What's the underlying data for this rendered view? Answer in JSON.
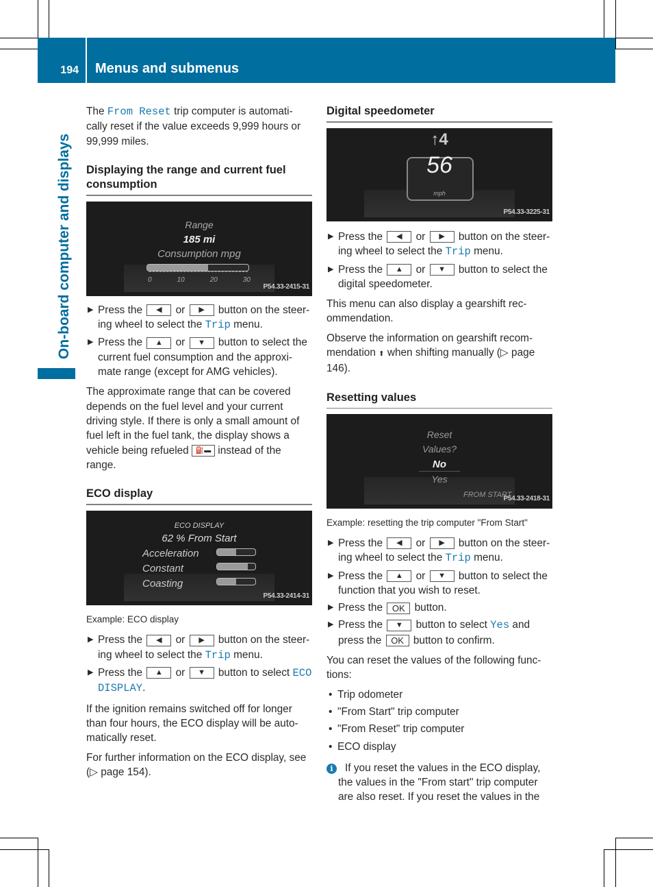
{
  "header": {
    "page_number": "194",
    "title": "Menus and submenus"
  },
  "side_tab": {
    "label": "On-board computer and displays"
  },
  "left": {
    "intro": {
      "pre": "The ",
      "code": "From Reset",
      "post": " trip computer is automati-cally reset if the value exceeds 9,999 hours or 99,999 miles."
    },
    "range_section": {
      "heading": "Displaying the range and current fuel consumption",
      "screen": {
        "label_range": "Range",
        "range_value": "185 mi",
        "label_consumption": "Consumption mpg",
        "consumption_fill_fraction": 0.6,
        "scale_ticks": [
          "0",
          "10",
          "20",
          "30"
        ],
        "figure_code": "P54.33-2415-31"
      },
      "steps": [
        {
          "a": "Press the ",
          "k1": "◀",
          "or": " or ",
          "k2": "▶",
          "b": " button on the steer-ing wheel to select the ",
          "code": "Trip",
          "c": " menu."
        },
        {
          "a": "Press the ",
          "k1": "▲",
          "or": " or ",
          "k2": "▼",
          "b": " button to select the current fuel consumption and the approxi-mate range (except for AMG vehicles)."
        }
      ],
      "para_pre": "The approximate range that can be covered depends on the fuel level and your current driving style. If there is only a small amount of fuel left in the fuel tank, the display shows a vehicle being refueled ",
      "refuel_icon": "⛽🚗",
      "para_post": " instead of the range."
    },
    "eco_section": {
      "heading": "ECO display",
      "screen": {
        "title": "ECO DISPLAY",
        "subtitle": "62 % From Start",
        "rows": [
          {
            "label": "Acceleration",
            "fill": 0.5
          },
          {
            "label": "Constant",
            "fill": 0.8
          },
          {
            "label": "Coasting",
            "fill": 0.5
          }
        ],
        "figure_code": "P54.33-2414-31"
      },
      "caption": "Example: ECO display",
      "steps": [
        {
          "a": "Press the ",
          "k1": "◀",
          "or": " or ",
          "k2": "▶",
          "b": " button on the steer-ing wheel to select the ",
          "code": "Trip",
          "c": " menu."
        },
        {
          "a": "Press the ",
          "k1": "▲",
          "or": " or ",
          "k2": "▼",
          "b": " button to select ",
          "code": "ECO DISPLAY",
          "c": "."
        }
      ],
      "para1": "If the ignition remains switched off for longer than four hours, the ECO display will be auto-matically reset.",
      "para2": "For further information on the ECO display, see (▷ page 154)."
    }
  },
  "right": {
    "speedo_section": {
      "heading": "Digital speedometer",
      "screen": {
        "gear_hint": "↑4",
        "speed": "56",
        "unit": "mph",
        "figure_code": "P54.33-3225-31"
      },
      "steps": [
        {
          "a": "Press the ",
          "k1": "◀",
          "or": " or ",
          "k2": "▶",
          "b": " button on the steer-ing wheel to select the ",
          "code": "Trip",
          "c": " menu."
        },
        {
          "a": "Press the ",
          "k1": "▲",
          "or": " or ",
          "k2": "▼",
          "b": " button to select the digital speedometer."
        }
      ],
      "para1": "This menu can also display a gearshift rec-ommendation.",
      "para2_pre": "Observe the information on gearshift recom-mendation ",
      "para2_icon": "⬆",
      "para2_post": " when shifting manually (▷ page 146)."
    },
    "reset_section": {
      "heading": "Resetting values",
      "screen": {
        "line1": "Reset",
        "line2": "Values?",
        "opt_no": "No",
        "opt_yes": "Yes",
        "footer": "FROM START",
        "figure_code": "P54.33-2418-31"
      },
      "caption": "Example: resetting the trip computer \"From Start\"",
      "steps": [
        {
          "a": "Press the ",
          "k1": "◀",
          "or": " or ",
          "k2": "▶",
          "b": " button on the steer-ing wheel to select the ",
          "code": "Trip",
          "c": " menu."
        },
        {
          "a": "Press the ",
          "k1": "▲",
          "or": " or ",
          "k2": "▼",
          "b": " button to select the function that you wish to reset."
        },
        {
          "a": "Press the ",
          "k1": "OK",
          "b": " button."
        },
        {
          "a": "Press the ",
          "k1": "▼",
          "b": " button to select ",
          "code": "Yes",
          "c": " and press the ",
          "k2": "OK",
          "d": " button to confirm."
        }
      ],
      "para": "You can reset the values of the following func-tions:",
      "bullets": [
        "Trip odometer",
        "\"From Start\" trip computer",
        "\"From Reset\" trip computer",
        "ECO display"
      ],
      "note": "If you reset the values in the ECO display, the values in the \"From start\" trip computer are also reset. If you reset the values in the"
    }
  },
  "colors": {
    "brand": "#006e9f",
    "code_text": "#1a7ab0"
  }
}
